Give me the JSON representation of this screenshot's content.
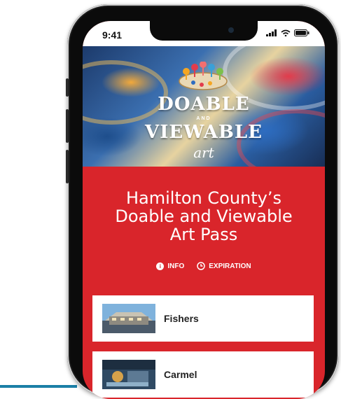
{
  "status_bar": {
    "time": "9:41"
  },
  "hero": {
    "line1": "DOABLE",
    "connector": "AND",
    "line2": "VIEWABLE",
    "line3": "art"
  },
  "main": {
    "title_line1": "Hamilton County’s",
    "title_line2": "Doable and Viewable",
    "title_line3": "Art Pass"
  },
  "links": [
    {
      "label": "INFO",
      "icon": "info-icon"
    },
    {
      "label": "EXPIRATION",
      "icon": "clock-icon"
    }
  ],
  "locations": [
    {
      "label": "Fishers",
      "icon": "location-thumbnail"
    },
    {
      "label": "Carmel",
      "icon": "location-thumbnail"
    }
  ],
  "colors": {
    "brand_red": "#d9252b",
    "card_bg": "#ffffff",
    "accent_blue": "#1b7fa6"
  }
}
